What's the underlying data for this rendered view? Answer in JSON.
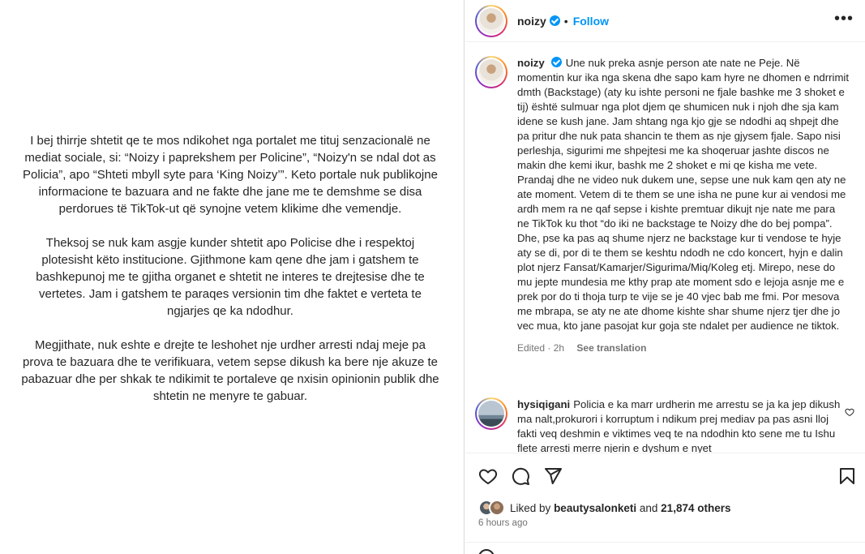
{
  "image_text": {
    "paragraphs": [
      "I bej thirrje shtetit qe te mos ndikohet nga portalet me tituj senzacionalë ne mediat sociale, si: “Noizy i paprekshem per Policine”, “Noizy'n se ndal dot as Policia”, apo “Shteti mbyll syte para ‘King Noizy’”. Keto portale nuk publikojne informacione te bazuara and ne fakte dhe jane me te demshme se disa perdorues të TikTok-ut që synojne vetem klikime dhe vemendje.",
      "Theksoj se nuk kam asgje kunder shtetit apo Policise dhe i respektoj plotesisht këto institucione. Gjithmone kam qene dhe jam i gatshem te bashkepunoj me te gjitha organet e shtetit ne interes te drejtesise dhe te vertetes. Jam i gatshem te paraqes versionin tim dhe faktet e verteta te ngjarjes qe ka ndodhur.",
      "Megjithate, nuk eshte e drejte te leshohet nje urdher arresti ndaj meje pa prova te bazuara dhe te verifikuara, vetem sepse dikush ka bere nje akuze te pabazuar dhe per shkak te ndikimit te portaleve qe nxisin opinionin publik dhe shtetin ne menyre te gabuar."
    ]
  },
  "header": {
    "username": "noizy",
    "dot": "•",
    "follow_label": "Follow",
    "more_label": "•••"
  },
  "caption": {
    "username": "noizy",
    "text": "Une nuk preka asnje person ate nate ne Peje. Në momentin kur ika nga skena dhe sapo kam hyre ne dhomen e ndrrimit dmth (Backstage) (aty ku ishte personi ne fjale bashke me 3 shoket e tij) është sulmuar nga plot djem qe shumicen nuk i njoh dhe sja kam idene se kush jane. Jam shtang nga kjo gje se ndodhi aq shpejt dhe pa pritur dhe nuk pata shancin te them as nje gjysem fjale. Sapo nisi perleshja, sigurimi me shpejtesi me ka shoqeruar jashte discos ne makin dhe kemi ikur, bashk me 2 shoket e mi qe kisha me vete. Prandaj dhe ne video nuk dukem une, sepse une nuk kam qen aty ne ate moment. Vetem di te them se une isha ne pune kur ai vendosi me ardh mem ra ne qaf sepse i kishte premtuar dikujt nje nate me para ne TikTok ku thot “do iki ne backstage te Noizy dhe do bej pompa”. Dhe, pse ka pas aq shume njerz ne backstage kur ti vendose te hyje aty se di, por di te them se keshtu ndodh ne cdo koncert, hyjn e dalin plot njerz Fansat/Kamarjer/Sigurima/Miq/Koleg etj. Mirepo, nese do mu jepte mundesia me kthy prap ate moment sdo e lejoja asnje me e prek por do ti thoja turp te vije se je 40 vjec bab me fmi. Por mesova me mbrapa, se aty ne ate dhome kishte shar shume njerz tjer dhe jo vec mua, kto jane pasojat kur goja ste ndalet per audience ne tiktok.",
    "edited": "Edited · 2h",
    "see_translation": "See translation"
  },
  "comment": {
    "username": "hysiqigani",
    "text": "Policia e ka marr urdherin me arrestu se ja ka jep dikush ma nalt,prokurori i korruptum i ndikum prej mediav pa pas asni lloj fakti veq deshmin e viktimes veq te na ndodhin kto sene me tu Ishu flete arresti merre njerin e dyshum e nyet"
  },
  "footer": {
    "liked_by_prefix": "Liked by",
    "liked_by_user": "beautysalonketi",
    "and": "and",
    "others": "21,874 others",
    "time_ago": "6 hours ago"
  },
  "icons": {
    "like": "heart-icon",
    "comment": "comment-icon",
    "share": "share-icon",
    "save": "bookmark-icon",
    "verified": "verified-badge-icon"
  },
  "colors": {
    "accent": "#0095f6",
    "text": "#262626",
    "muted": "#737373",
    "border": "#dbdbdb"
  }
}
